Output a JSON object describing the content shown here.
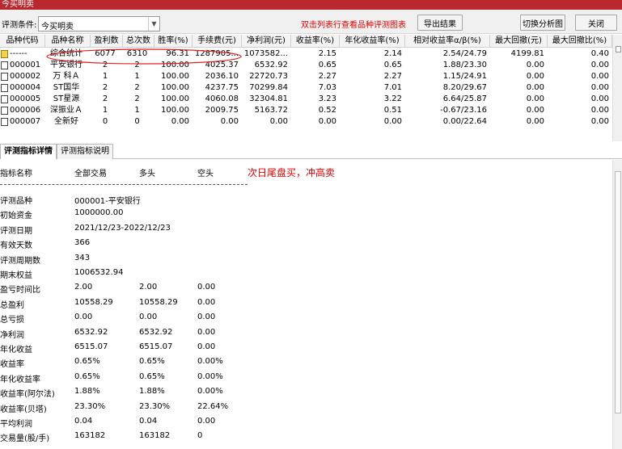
{
  "window": {
    "title": "今买明卖"
  },
  "toolbar": {
    "label": "评测条件:",
    "combo_value": "今买明卖",
    "hint": "双击列表行查看品种评测图表",
    "export_label": "导出结果",
    "switch_label": "切换分析图",
    "close_label": "关闭"
  },
  "table": {
    "headers": [
      "品种代码",
      "品种名称",
      "盈利数",
      "总次数",
      "胜率(%)",
      "手续费(元)",
      "净利润(元)",
      "收益率(%)",
      "年化收益率(%)",
      "相对收益率α/β(%)",
      "最大回撤(元)",
      "最大回撤比(%)"
    ],
    "rows": [
      [
        "------",
        "综合统计",
        "6077",
        "6310",
        "96.31",
        "1287905...",
        "1073582...",
        "2.15",
        "2.14",
        "2.54/24.79",
        "4199.81",
        "0.40"
      ],
      [
        "000001",
        "平安银行",
        "2",
        "2",
        "100.00",
        "4025.37",
        "6532.92",
        "0.65",
        "0.65",
        "1.88/23.30",
        "0.00",
        "0.00"
      ],
      [
        "000002",
        "万 科Ａ",
        "1",
        "1",
        "100.00",
        "2036.10",
        "22720.73",
        "2.27",
        "2.27",
        "1.15/24.91",
        "0.00",
        "0.00"
      ],
      [
        "000004",
        "ST国华",
        "2",
        "2",
        "100.00",
        "4237.75",
        "70299.84",
        "7.03",
        "7.01",
        "8.20/29.67",
        "0.00",
        "0.00"
      ],
      [
        "000005",
        "ST星源",
        "2",
        "2",
        "100.00",
        "4060.08",
        "32304.81",
        "3.23",
        "3.22",
        "6.64/25.87",
        "0.00",
        "0.00"
      ],
      [
        "000006",
        "深振业Ａ",
        "1",
        "1",
        "100.00",
        "2009.75",
        "5163.72",
        "0.52",
        "0.51",
        "-0.67/23.16",
        "0.00",
        "0.00"
      ],
      [
        "000007",
        "全新好",
        "0",
        "0",
        "0.00",
        "0.00",
        "0.00",
        "0.00",
        "0.00",
        "0.00/22.64",
        "0.00",
        "0.00"
      ]
    ]
  },
  "tabs": [
    {
      "label": "评测指标详情"
    },
    {
      "label": "评测指标说明"
    }
  ],
  "detail": {
    "headers": [
      "指标名称",
      "全部交易",
      "多头",
      "空头"
    ],
    "note": "次日尾盘买，冲高卖",
    "rows": [
      [
        "评测品种",
        "000001-平安银行",
        "",
        ""
      ],
      [
        "初始资金",
        "1000000.00",
        "",
        ""
      ],
      [
        "评测日期",
        "2021/12/23-2022/12/23",
        "",
        ""
      ],
      [
        "有效天数",
        "366",
        "",
        ""
      ],
      [
        "评测周期数",
        "343",
        "",
        ""
      ],
      [
        "期末权益",
        "1006532.94",
        "",
        ""
      ],
      [
        "盈亏时间比",
        "2.00",
        "2.00",
        "0.00"
      ],
      [
        "总盈利",
        "10558.29",
        "10558.29",
        "0.00"
      ],
      [
        "总亏损",
        "0.00",
        "0.00",
        "0.00"
      ],
      [
        "净利润",
        "6532.92",
        "6532.92",
        "0.00"
      ],
      [
        "年化收益",
        "6515.07",
        "6515.07",
        "0.00"
      ],
      [
        "收益率",
        "0.65%",
        "0.65%",
        "0.00%"
      ],
      [
        "年化收益率",
        "0.65%",
        "0.65%",
        "0.00%"
      ],
      [
        "收益率(阿尔法)",
        "1.88%",
        "1.88%",
        "0.00%"
      ],
      [
        "收益率(贝塔)",
        "23.30%",
        "23.30%",
        "22.64%"
      ],
      [
        "平均利润",
        "0.04",
        "0.04",
        "0.00"
      ],
      [
        "交易量(股/手)",
        "163182",
        "163182",
        "0"
      ]
    ]
  },
  "colors": {
    "title_bar": "#b8282e",
    "hint_red": "#e00000",
    "summary_icon": "#f5d24b"
  }
}
